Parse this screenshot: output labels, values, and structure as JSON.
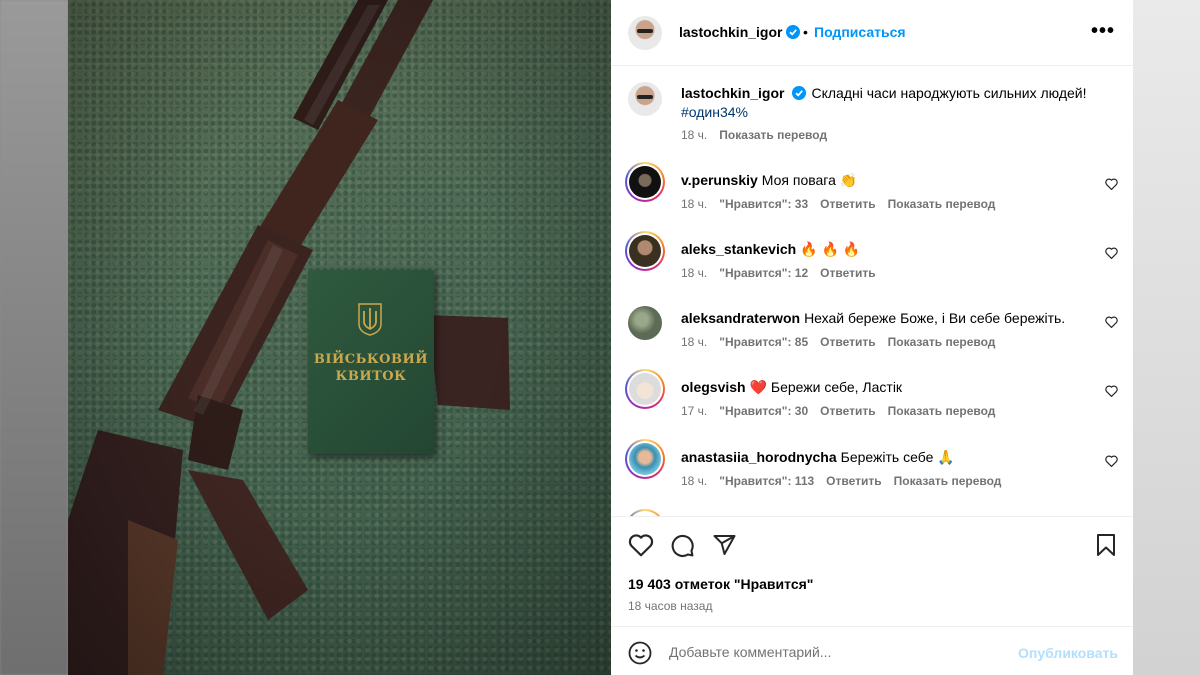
{
  "post": {
    "author": "lastochkin_igor",
    "follow_label": "Подписаться",
    "separator": "•",
    "more_label": "•••"
  },
  "photo": {
    "booklet_line1": "ВІЙСЬКОВИЙ",
    "booklet_line2": "КВИТОК"
  },
  "caption": {
    "username": "lastochkin_igor",
    "text": "Складні часи народжують сильних людей!",
    "hashtag": "#один34%",
    "time": "18 ч.",
    "translate": "Показать перевод"
  },
  "comments": [
    {
      "username": "v.perunskiy",
      "text": "Моя повага 👏",
      "time": "18 ч.",
      "likes": "\"Нравится\": 33",
      "reply": "Ответить",
      "translate": "Показать перевод"
    },
    {
      "username": "aleks_stankevich",
      "text": "🔥 🔥 🔥",
      "time": "18 ч.",
      "likes": "\"Нравится\": 12",
      "reply": "Ответить",
      "translate": ""
    },
    {
      "username": "aleksandraterwon",
      "text": "Нехай береже Боже, і Ви себе бережіть.",
      "time": "18 ч.",
      "likes": "\"Нравится\": 85",
      "reply": "Ответить",
      "translate": "Показать перевод"
    },
    {
      "username": "olegsvish",
      "text": "❤️ Бережи себе, Ластік",
      "time": "17 ч.",
      "likes": "\"Нравится\": 30",
      "reply": "Ответить",
      "translate": "Показать перевод"
    },
    {
      "username": "anastasiia_horodnycha",
      "text": "Бережіть себе 🙏",
      "time": "18 ч.",
      "likes": "\"Нравится\": 113",
      "reply": "Ответить",
      "translate": "Показать перевод"
    }
  ],
  "footer": {
    "likes": "19 403 отметок \"Нравится\"",
    "time_ago": "18 часов назад",
    "comment_placeholder": "Добавьте комментарий...",
    "publish_label": "Опубликовать"
  },
  "colors": {
    "accent": "#0095f6",
    "hashtag": "#00376b",
    "muted": "#737373",
    "publish_disabled": "#b2dffc"
  }
}
